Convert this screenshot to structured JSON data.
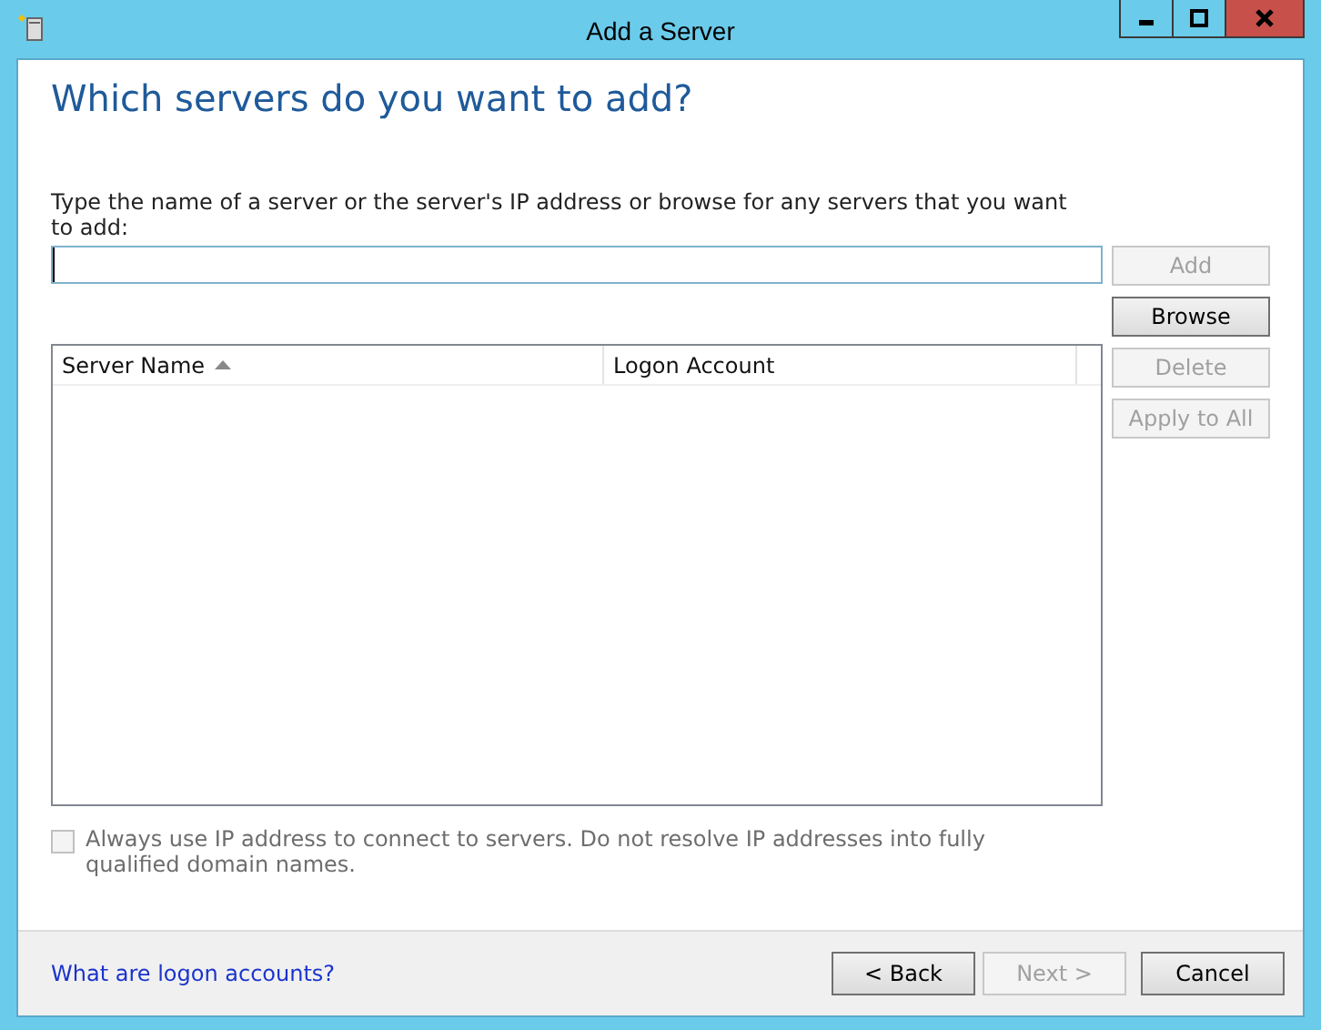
{
  "window": {
    "title": "Add a Server"
  },
  "heading": "Which servers do you want to add?",
  "instruction": "Type the name of a server or the server's IP address or browse for any servers that you want to add:",
  "server_field": {
    "focused": true
  },
  "side_buttons": [
    {
      "label": "Add",
      "disabled": true
    },
    {
      "label": "Browse",
      "disabled": false
    },
    {
      "label": "Delete",
      "disabled": true
    },
    {
      "label": "Apply to All",
      "disabled": true
    }
  ],
  "table": {
    "columns": [
      {
        "label": "Server Name",
        "sorted": true
      },
      {
        "label": "Logon Account",
        "sorted": false
      }
    ]
  },
  "ip_option": {
    "label": "Always use IP address to connect to servers. Do not resolve IP addresses into fully qualified domain names.",
    "checked": false,
    "disabled": true
  },
  "footer": {
    "link": "What are logon accounts?",
    "buttons": [
      {
        "label": "< Back",
        "disabled": false
      },
      {
        "label": "Next >",
        "disabled": true
      },
      {
        "label": "Cancel",
        "disabled": false
      }
    ]
  }
}
